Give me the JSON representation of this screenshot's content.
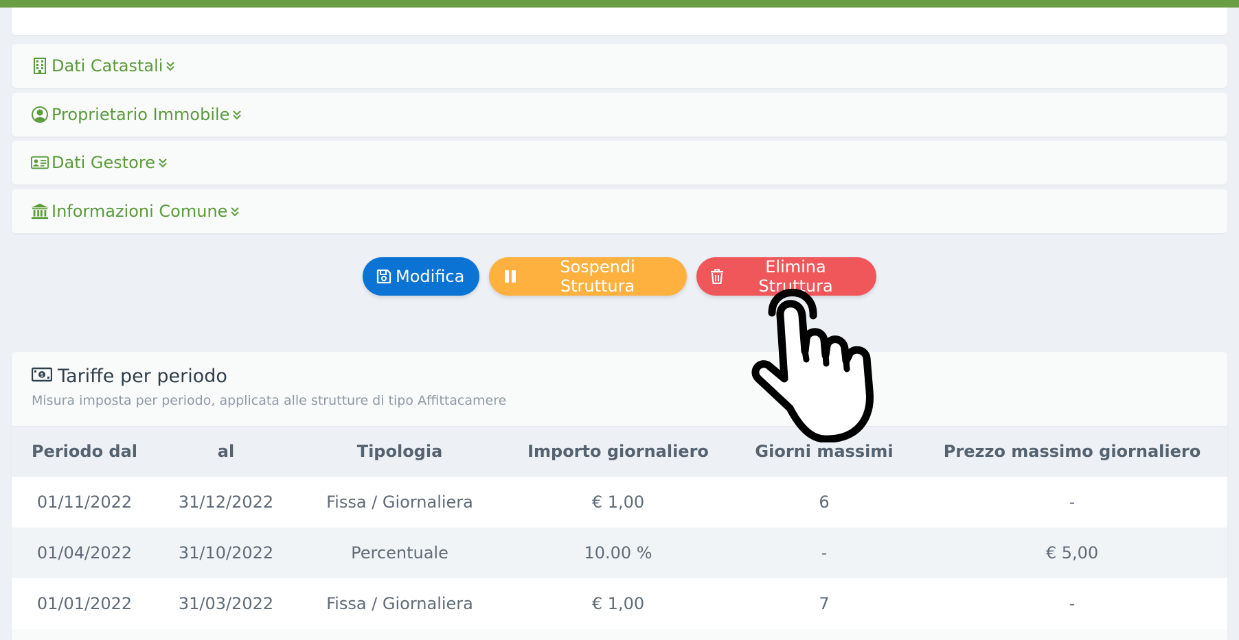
{
  "sections": [
    {
      "label": "Dati Catastali",
      "icon": "building-icon"
    },
    {
      "label": "Proprietario Immobile",
      "icon": "user-circle-icon"
    },
    {
      "label": "Dati Gestore",
      "icon": "id-card-icon"
    },
    {
      "label": "Informazioni Comune",
      "icon": "bank-icon"
    }
  ],
  "actions": {
    "edit_label": "Modifica",
    "suspend_label": "Sospendi Struttura",
    "delete_label": "Elimina Struttura"
  },
  "colors": {
    "accent_green": "#5a9b3a",
    "top_bar": "#689f45",
    "edit": "#0a73d4",
    "suspend": "#feb13e",
    "delete": "#f0575a"
  },
  "rates": {
    "title": "Tariffe per periodo",
    "subtitle": "Misura imposta per periodo, applicata alle strutture di tipo Affittacamere",
    "columns": [
      "Periodo dal",
      "al",
      "Tipologia",
      "Importo giornaliero",
      "Giorni massimi",
      "Prezzo massimo giornaliero"
    ],
    "rows": [
      [
        "01/11/2022",
        "31/12/2022",
        "Fissa / Giornaliera",
        "€ 1,00",
        "6",
        "-"
      ],
      [
        "01/04/2022",
        "31/10/2022",
        "Percentuale",
        "10.00 %",
        "-",
        "€ 5,00"
      ],
      [
        "01/01/2022",
        "31/03/2022",
        "Fissa / Giornaliera",
        "€ 1,00",
        "7",
        "-"
      ]
    ]
  }
}
